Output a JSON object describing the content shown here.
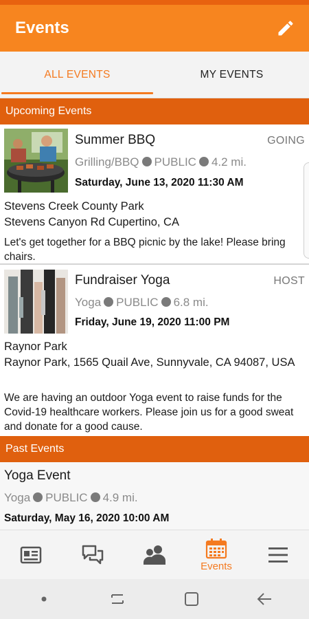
{
  "app": {
    "title": "Events"
  },
  "tabs": [
    {
      "label": "ALL EVENTS",
      "active": true
    },
    {
      "label": "MY EVENTS",
      "active": false
    }
  ],
  "sections": {
    "upcoming": "Upcoming Events",
    "past": "Past Events"
  },
  "events": [
    {
      "title": "Summer BBQ",
      "role": "GOING",
      "category": "Grilling/BBQ",
      "visibility": "PUBLIC",
      "distance": "4.2 mi.",
      "datetime": "Saturday, June 13, 2020 11:30 AM",
      "location_name": "Stevens Creek County Park",
      "address": "Stevens Canyon Rd Cupertino, CA",
      "description": "Let's get together for a BBQ picnic by the lake! Please bring chairs."
    },
    {
      "title": "Fundraiser Yoga",
      "role": "HOST",
      "category": "Yoga",
      "visibility": "PUBLIC",
      "distance": "6.8 mi.",
      "datetime": "Friday, June 19, 2020 11:00 PM",
      "location_name": "Raynor Park",
      "address": "Raynor Park, 1565 Quail Ave, Sunnyvale, CA 94087, USA",
      "description": "We are having an outdoor Yoga event to raise funds for the Covid-19 healthcare workers. Please join us for a good sweat and donate for a good cause."
    }
  ],
  "past_events": [
    {
      "title": "Yoga Event",
      "category": "Yoga",
      "visibility": "PUBLIC",
      "distance": "4.9 mi.",
      "datetime": "Saturday, May 16, 2020 10:00 AM"
    }
  ],
  "bottom_nav": [
    {
      "icon": "news-icon",
      "label": ""
    },
    {
      "icon": "chat-icon",
      "label": ""
    },
    {
      "icon": "people-icon",
      "label": ""
    },
    {
      "icon": "calendar-icon",
      "label": "Events",
      "active": true
    },
    {
      "icon": "menu-icon",
      "label": ""
    }
  ],
  "colors": {
    "primary": "#f7851f",
    "section": "#e0600e",
    "accent": "#f47a20"
  }
}
